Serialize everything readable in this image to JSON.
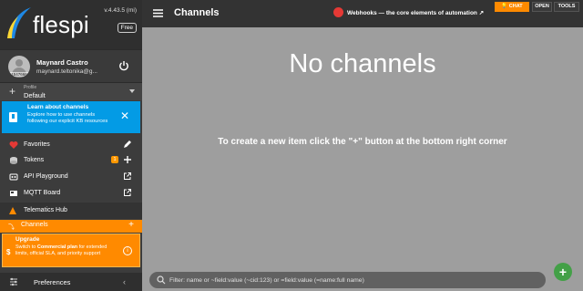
{
  "brand": {
    "name": "flespi",
    "version": "v.4.43.5 (mi)",
    "plan": "Free"
  },
  "user": {
    "name": "Maynard Castro",
    "email": "maynard.teltonika@g...",
    "avatar_id": "1547666"
  },
  "profile": {
    "caption": "Profile",
    "value": "Default"
  },
  "info_banner": {
    "title": "Learn about channels",
    "text": "Explore how to use channels following our explicit KB resources"
  },
  "nav": {
    "favorites": "Favorites",
    "tokens": "Tokens",
    "tokens_badge": "1",
    "api_playground": "API Playground",
    "mqtt_board": "MQTT Board",
    "telematics_hub": "Telematics Hub",
    "channels": "Channels"
  },
  "upgrade": {
    "title": "Upgrade",
    "text_pre": "Switch to ",
    "text_bold": "Commercial plan",
    "text_post": " for extended limits, official SLA, and priority support"
  },
  "preferences": "Preferences",
  "topbar": {
    "title": "Channels",
    "announcement": "Webhooks — the core elements of automation",
    "chat": "CHAT",
    "open": "OPEN",
    "tools": "TOOLS"
  },
  "main": {
    "empty_title": "No channels",
    "empty_hint": "To create a new item click the \"+\" button at the bottom right corner"
  },
  "filter": {
    "placeholder": "Filter: name or ~field:value (~cid:123) or =field:value (=name:full name)"
  },
  "fab": "+",
  "colors": {
    "accent": "#ff8a00",
    "info": "#039be5",
    "fab": "#43a047",
    "announce": "#e53935"
  }
}
